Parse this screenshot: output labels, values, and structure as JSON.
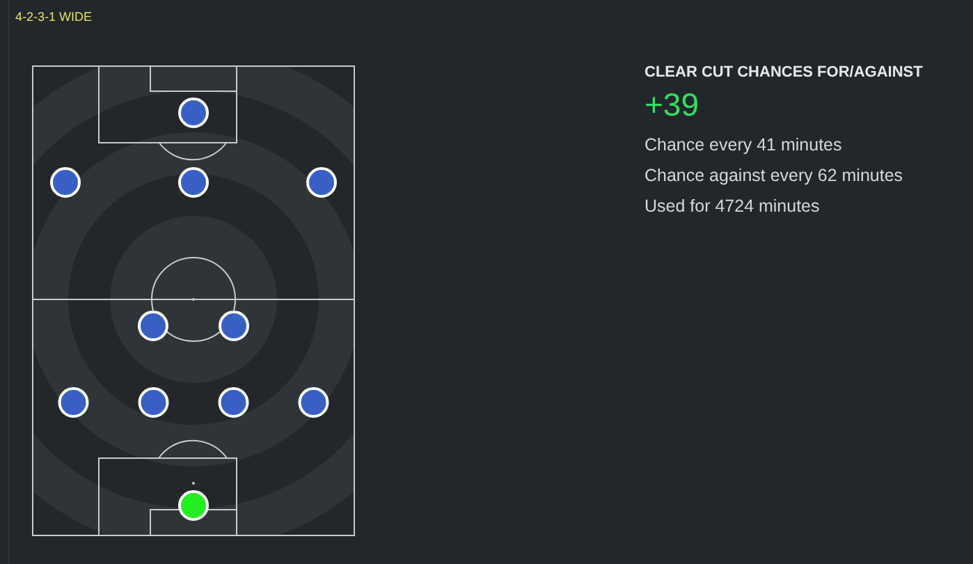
{
  "formation": "4-2-3-1 WIDE",
  "lines": [
    {
      "kind": "striker",
      "players": [
        {
          "color": "#3a5fc4"
        }
      ]
    },
    {
      "kind": "attacking",
      "players": [
        {
          "color": "#3a5fc4"
        },
        {
          "color": "#3a5fc4"
        },
        {
          "color": "#3a5fc4"
        }
      ]
    },
    {
      "kind": "holding",
      "players": [
        {
          "color": "#3a5fc4"
        },
        {
          "color": "#3a5fc4"
        }
      ]
    },
    {
      "kind": "defence",
      "players": [
        {
          "color": "#3a5fc4"
        },
        {
          "color": "#3a5fc4"
        },
        {
          "color": "#3a5fc4"
        },
        {
          "color": "#3a5fc4"
        }
      ]
    },
    {
      "kind": "goalkeeper",
      "players": [
        {
          "color": "#22ee22"
        }
      ]
    }
  ],
  "stats": {
    "title": "CLEAR CUT CHANCES FOR/AGAINST",
    "value": "+39",
    "lines": [
      "Chance every 41 minutes",
      "Chance against every 62 minutes",
      "Used for 4724 minutes"
    ]
  }
}
